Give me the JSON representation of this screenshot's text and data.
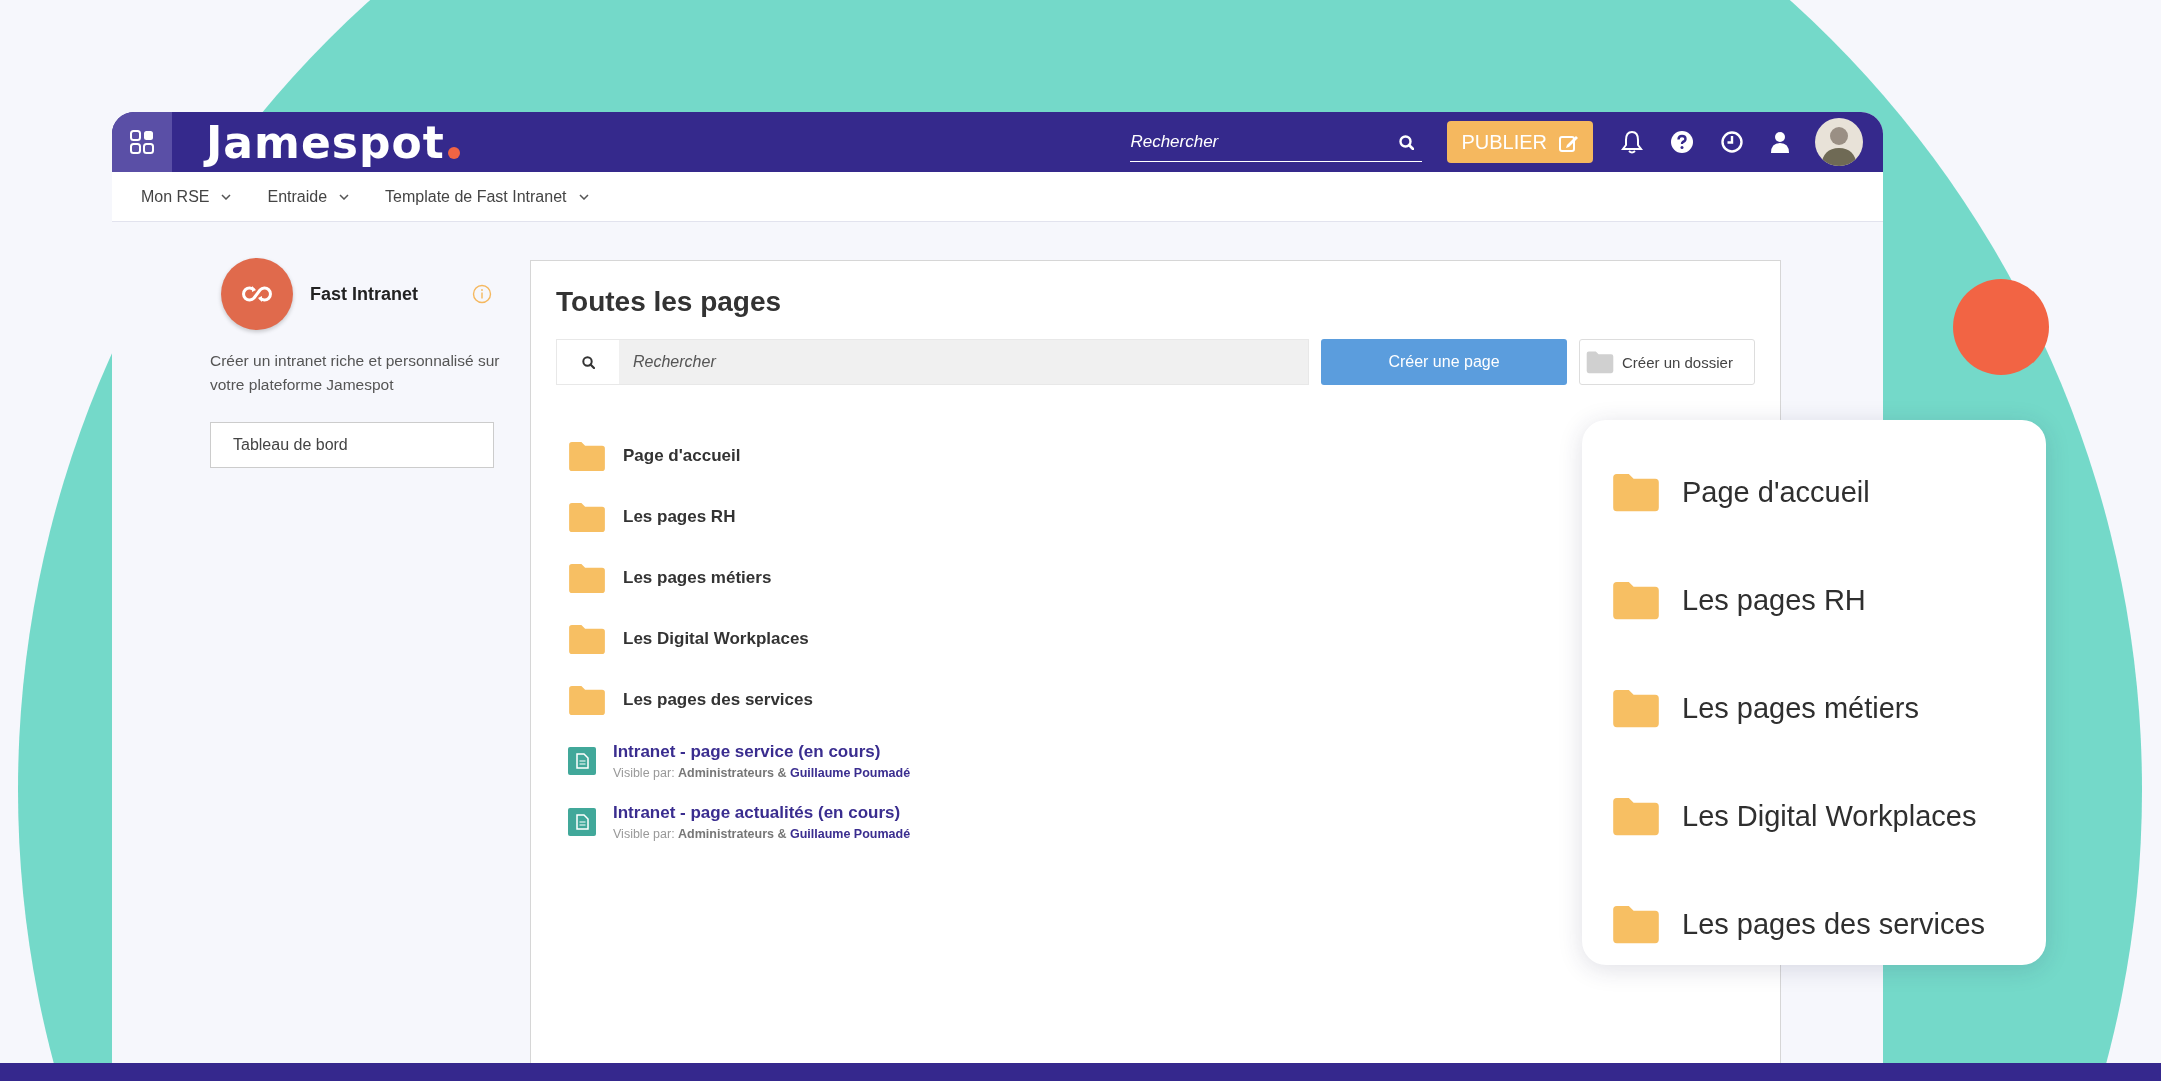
{
  "header": {
    "logo": "Jamespot",
    "search_placeholder": "Rechercher",
    "publish_button": "PUBLIER"
  },
  "nav": [
    {
      "label": "Mon RSE"
    },
    {
      "label": "Entraide"
    },
    {
      "label": "Template de Fast Intranet"
    }
  ],
  "sidebar": {
    "title": "Fast Intranet",
    "description": "Créer un intranet riche et personnalisé sur votre plateforme Jamespot",
    "button": "Tableau de bord"
  },
  "main": {
    "title": "Toutes les pages",
    "search_placeholder": "Rechercher",
    "create_page_button": "Créer une page",
    "create_folder_button": "Créer un dossier",
    "items": [
      {
        "kind": "folder",
        "title": "Page d'accueil"
      },
      {
        "kind": "folder",
        "title": "Les pages RH"
      },
      {
        "kind": "folder",
        "title": "Les pages métiers"
      },
      {
        "kind": "folder",
        "title": "Les Digital Workplaces"
      },
      {
        "kind": "folder",
        "title": "Les pages des services"
      },
      {
        "kind": "page",
        "title": "Intranet - page service (en cours)",
        "visibility": "Visible par: **Administrateurs &**",
        "owner": "Guillaume Poumadé"
      },
      {
        "kind": "page",
        "title": "Intranet - page actualités (en cours)",
        "visibility": "Visible par: **Administrateurs &**",
        "owner": "Guillaume Poumadé"
      }
    ]
  },
  "callout": {
    "items": [
      {
        "title": "Page d'accueil"
      },
      {
        "title": "Les pages RH"
      },
      {
        "title": "Les pages métiers"
      },
      {
        "title": "Les Digital Workplaces"
      },
      {
        "title": "Les pages des services"
      }
    ]
  }
}
